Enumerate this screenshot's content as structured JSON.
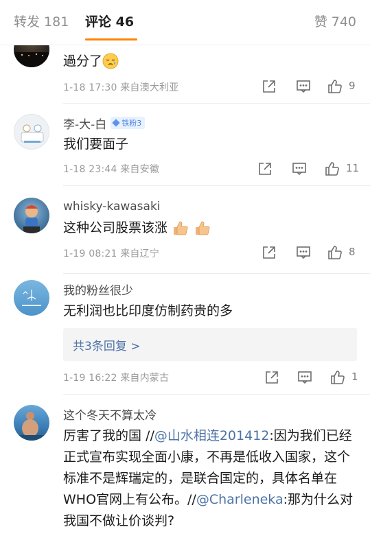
{
  "tabs": {
    "repost": "转发 181",
    "comments": "评论 46",
    "likes": "赞 740"
  },
  "comments": [
    {
      "text": "過分了",
      "emoji": "sleepy-face-emoji",
      "time": "1-18 17:30",
      "source": "来自澳大利亚",
      "likes": "9"
    },
    {
      "username": "李-大-白",
      "badge": "铁粉3",
      "text": "我们要面子",
      "time": "1-18 23:44",
      "source": "来自安徽",
      "likes": "11"
    },
    {
      "username": "whisky-kawasaki",
      "text": "这种公司股票该涨",
      "emojis": [
        "thumbs-up-emoji",
        "thumbs-up-emoji"
      ],
      "time": "1-19 08:21",
      "source": "来自辽宁",
      "likes": "8"
    },
    {
      "username": "我的粉丝很少",
      "text": "无利润也比印度仿制药贵的多",
      "replies_label": "共3条回复 >",
      "time": "1-19 16:22",
      "source": "来自内蒙古",
      "likes": "1"
    },
    {
      "username": "这个冬天不算太冷",
      "text_parts": {
        "p1": "厉害了我的国 //",
        "mention1": "@山水相连201412",
        "p2": ":因为我们已经正式宣布实现全面小康，不再是低收入国家，这个标准不是辉瑞定的，是联合国定的，具体名单在WHO官网上有公布。//",
        "mention2": "@Charleneka",
        "p3": ":那为什么对我国不做让价谈判?"
      }
    }
  ],
  "colors": {
    "accent": "#ff8200",
    "link": "#4d73a7",
    "meta": "#9a9a9a"
  }
}
